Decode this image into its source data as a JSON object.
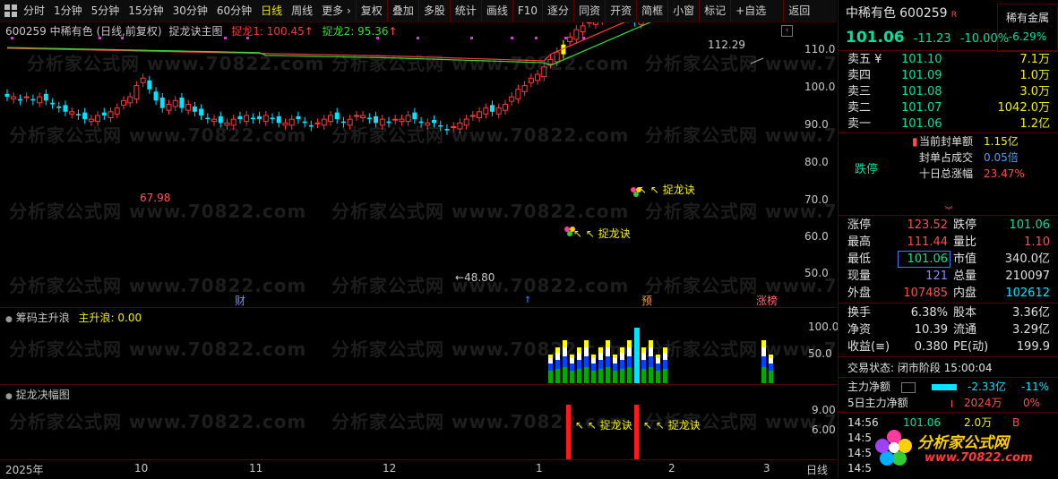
{
  "toolbar": {
    "items": [
      "分时",
      "1分钟",
      "5分钟",
      "15分钟",
      "30分钟",
      "60分钟",
      "日线",
      "周线",
      "更多 ›",
      "复权",
      "叠加",
      "多股",
      "统计",
      "画线",
      "F10",
      "逐分",
      "同资",
      "开资",
      "简框",
      "小窗",
      "标记",
      "+自选",
      "返回"
    ],
    "active": "日线"
  },
  "chart_header": {
    "code_name": "600259 中稀有色 (日线,前复权)",
    "indicator": "捉龙诀主图",
    "zl1": "捉龙1: 100.45",
    "zl2": "捉龙2: 95.36",
    "up_arrow": "↑"
  },
  "watermark": "分析家公式网 www.70822.com",
  "main_y_ticks": [
    "110.0",
    "100.0",
    "90.0",
    "80.0",
    "70.0",
    "60.0",
    "50.0"
  ],
  "annotations": {
    "high_label": "112.29",
    "label_6798": "67.98",
    "low_label": "48.80",
    "zlj1": "捉龙诀",
    "zlj2": "捉龙诀",
    "cai": "财",
    "yu": "预",
    "zhangbang": "涨榜"
  },
  "sub1": {
    "title": "筹码主升浪",
    "value_label": "主升浪: 0.00",
    "y_ticks": [
      "100.0",
      "50.0"
    ]
  },
  "sub2": {
    "title": "捉龙决幅图",
    "y_ticks": [
      "9.00",
      "6.00"
    ],
    "signal1": "捉龙诀",
    "signal2": "捉龙诀"
  },
  "xaxis": {
    "labels": [
      "2025年",
      "10",
      "11",
      "12",
      "1",
      "2",
      "3"
    ],
    "period": "日线"
  },
  "quote": {
    "name": "中稀有色",
    "code": "600259",
    "tag": "R",
    "rongzi": "稀有金属",
    "price": "101.06",
    "change": "-11.23",
    "change_pct": "-10.00%",
    "sector_pct": "-6.29%",
    "asks": [
      {
        "label": "卖五 ¥",
        "price": "101.10",
        "vol": "7.1万"
      },
      {
        "label": "卖四",
        "price": "101.09",
        "vol": "1.0万"
      },
      {
        "label": "卖三",
        "price": "101.08",
        "vol": "3.0万"
      },
      {
        "label": "卖二",
        "price": "101.07",
        "vol": "1042.0万"
      },
      {
        "label": "卖一",
        "price": "101.06",
        "vol": "1.2亿"
      }
    ],
    "limit_status": "跌停",
    "seal_amount_label": "当前封单额",
    "seal_amount": "1.15亿",
    "seal_ratio_label": "封单占成交",
    "seal_ratio": "0.05倍",
    "tenday_label": "十日总涨幅",
    "tenday": "23.47%",
    "stats": [
      {
        "l1": "涨停",
        "v1": "123.52",
        "l2": "跌停",
        "v2": "101.06"
      },
      {
        "l1": "最高",
        "v1": "111.44",
        "l2": "量比",
        "v2": "1.10"
      },
      {
        "l1": "最低",
        "v1": "101.06",
        "l2": "市值",
        "v2": "340.0亿"
      },
      {
        "l1": "现量",
        "v1": "121",
        "l2": "总量",
        "v2": "210097"
      },
      {
        "l1": "外盘",
        "v1": "107485",
        "l2": "内盘",
        "v2": "102612"
      }
    ],
    "fin": [
      {
        "l1": "换手",
        "v1": "6.38%",
        "l2": "股本",
        "v2": "3.36亿"
      },
      {
        "l1": "净资",
        "v1": "10.39",
        "l2": "流通",
        "v2": "3.29亿"
      },
      {
        "l1": "收益(≡)",
        "v1": "0.380",
        "l2": "PE(动)",
        "v2": "199.9"
      }
    ],
    "trade_status": "交易状态: 闭市阶段 15:00:04",
    "main_flow_label": "主力净额",
    "main_flow_val": "-2.33亿",
    "main_flow_pct": "-11%",
    "five_day_label": "5日主力净额",
    "five_day_val": "2024万",
    "five_day_pct": "0%",
    "ticks": [
      {
        "t": "14:56",
        "p": "101.06",
        "v": "2.0万",
        "s": "B"
      },
      {
        "t": "14:5",
        "p": "",
        "v": "",
        "s": ""
      },
      {
        "t": "14:5",
        "p": "",
        "v": "",
        "s": ""
      },
      {
        "t": "14:5",
        "p": "",
        "v": "",
        "s": ""
      }
    ],
    "logo_text": "分析家公式网",
    "logo_url": "www.70822.com"
  }
}
